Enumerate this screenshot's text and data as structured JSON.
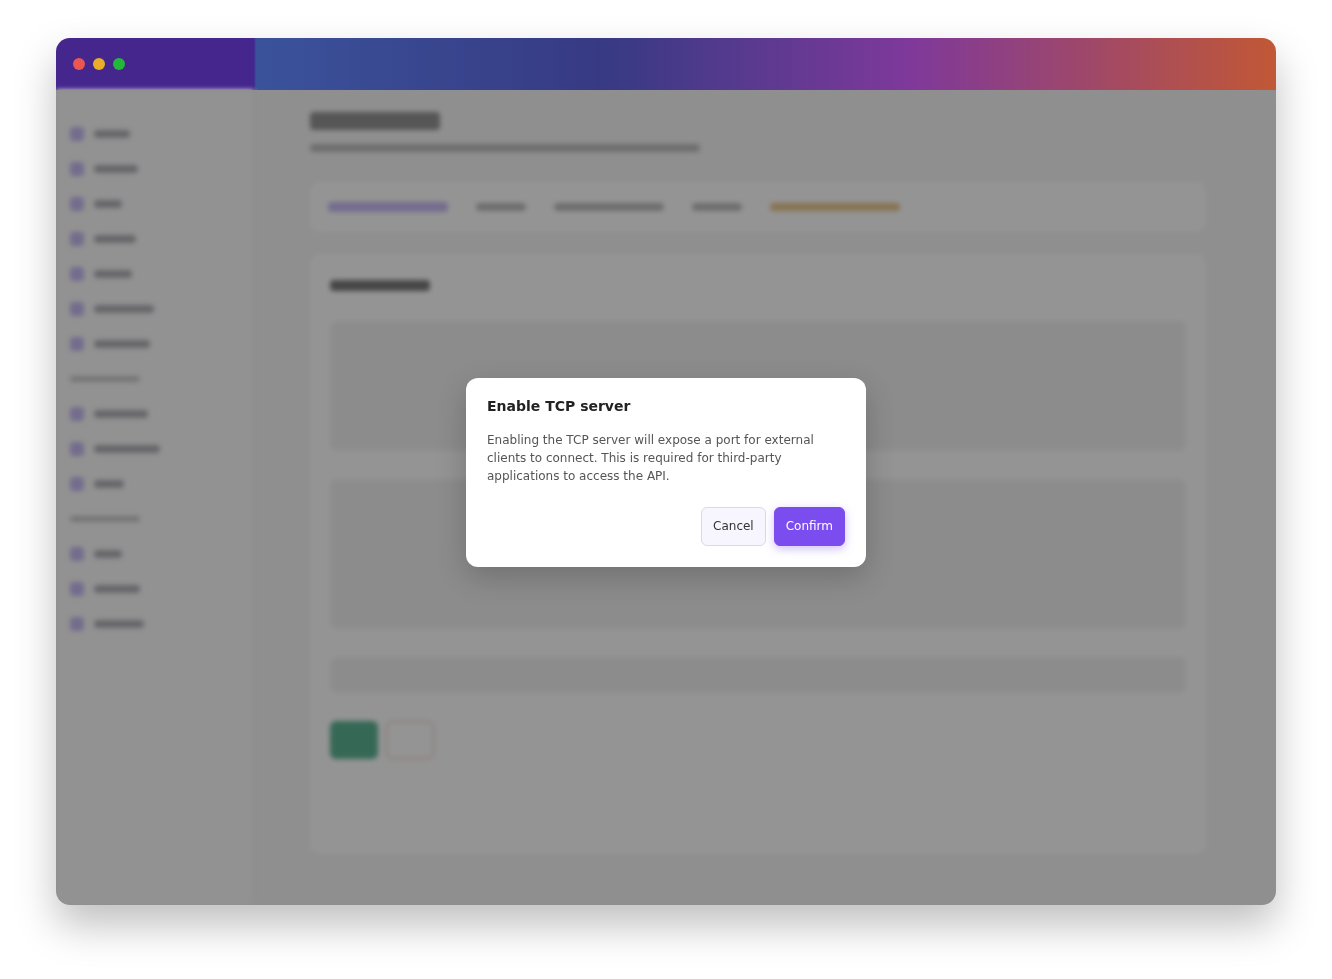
{
  "dialog": {
    "title": "Enable TCP server",
    "message": "Enabling the TCP server will expose a port for external clients to connect. This is required for third-party applications to access the API.",
    "buttons": [
      {
        "label": "Cancel",
        "kind": "secondary"
      },
      {
        "label": "Confirm",
        "kind": "primary"
      }
    ]
  }
}
